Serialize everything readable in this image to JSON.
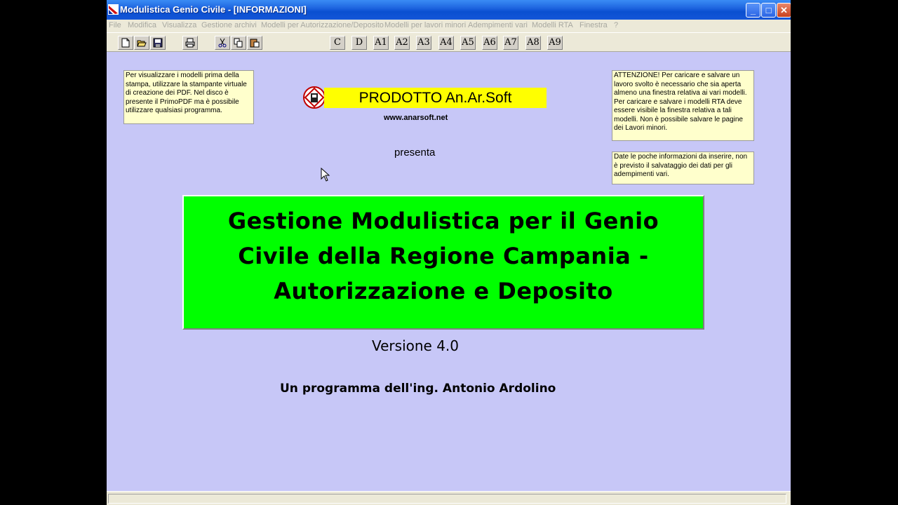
{
  "window": {
    "title": "Modulistica Genio Civile - [INFORMAZIONI]",
    "minimize_label": "_",
    "maximize_label": "□",
    "close_label": "✕"
  },
  "menu": [
    "File",
    "Modifica",
    "Visualizza",
    "Gestione archivi",
    "Modelli per Autorizzazione/Deposito",
    "Modelli per lavori minori",
    "Adempimenti vari",
    "Modelli RTA",
    "Finestra",
    "?"
  ],
  "toolbar": {
    "icon_buttons": [
      "new-document-icon",
      "open-folder-icon",
      "save-disk-icon",
      "print-icon",
      "cut-icon",
      "copy-icon",
      "paste-icon"
    ],
    "letter_buttons": [
      "C",
      "D",
      "A1",
      "A2",
      "A3",
      "A4",
      "A5",
      "A6",
      "A7",
      "A8",
      "A9"
    ]
  },
  "notes": {
    "left": "Per visualizzare i modelli prima della stampa, utilizzare la stampante virtuale di creazione dei PDF. Nel disco è presente il PrimoPDF ma è possibile utilizzare qualsiasi programma.",
    "right_top": "ATTENZIONE! Per caricare e salvare un lavoro svolto è necessario che sia aperta almeno una finestra relativa ai vari modelli. Per caricare e salvare i modelli RTA deve essere visibile la finestra relativa a tali modelli. Non è possibile salvare le pagine dei Lavori minori.",
    "right_bottom": "Date le poche informazioni da inserire, non è previsto il salvataggio dei dati per gli adempimenti vari."
  },
  "logo": {
    "banner": "PRODOTTO An.Ar.Soft"
  },
  "website": "www.anarsoft.net",
  "presenta": "presenta",
  "main_title_lines": [
    "Gestione Modulistica per il Genio",
    "Civile della Regione Campania -",
    "Autorizzazione e Deposito"
  ],
  "version": "Versione 4.0",
  "author": "Un programma dell'ing. Antonio Ardolino",
  "colors": {
    "background": "#c7c7f7",
    "title_box": "#00ff00",
    "logo_banner": "#ffff00",
    "note": "#ffffcc"
  }
}
